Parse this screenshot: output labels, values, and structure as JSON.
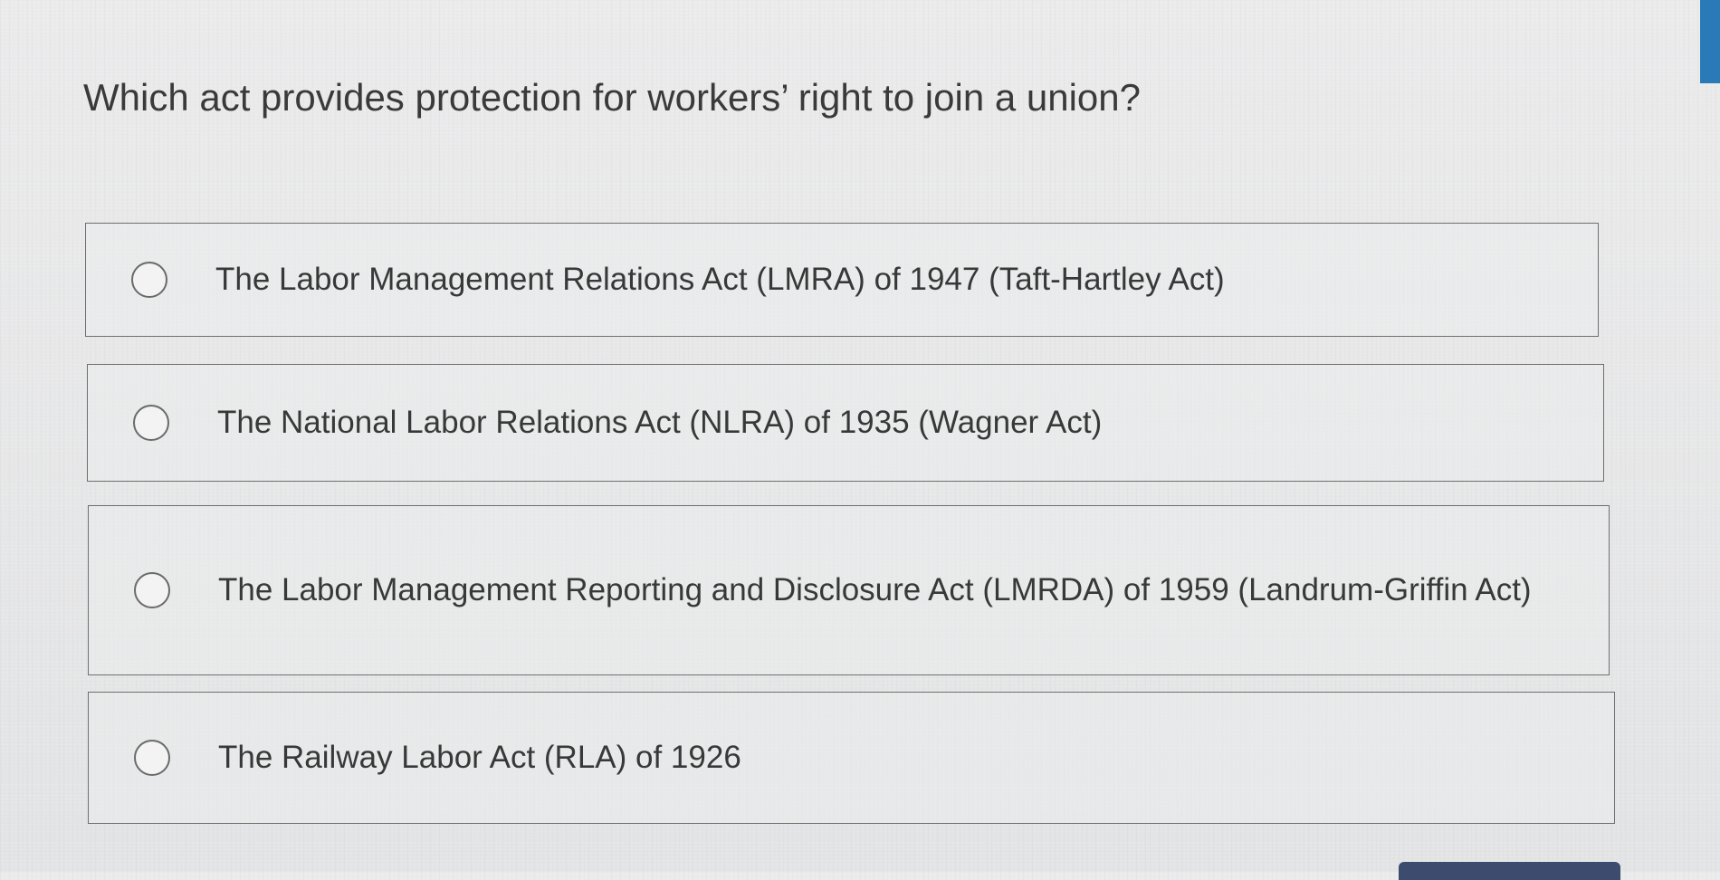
{
  "question": {
    "text": "Which act provides protection for workers’ right to join a union?"
  },
  "options": [
    {
      "label": "The Labor Management Relations Act (LMRA) of 1947 (Taft-Hartley Act)",
      "selected": false
    },
    {
      "label": "The National Labor Relations Act (NLRA) of 1935 (Wagner Act)",
      "selected": false
    },
    {
      "label": "The Labor Management Reporting and Disclosure Act (LMRDA) of 1959 (Landrum-Griffin Act)",
      "selected": false
    },
    {
      "label": "The Railway Labor Act (RLA) of 1926",
      "selected": false
    }
  ],
  "colors": {
    "accent": "#2a7ab8",
    "button": "#3d4c6e"
  }
}
